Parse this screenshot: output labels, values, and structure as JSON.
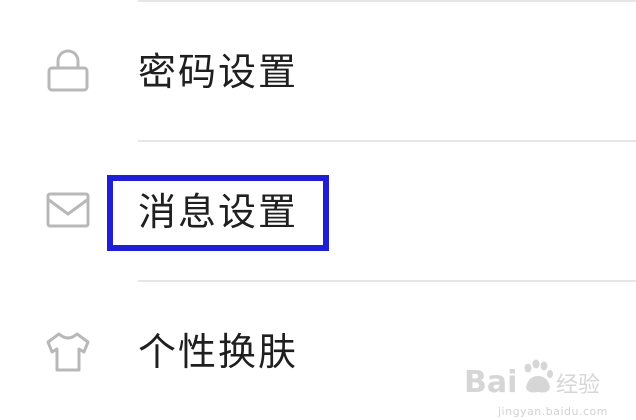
{
  "settings": {
    "items": [
      {
        "label": "密码设置",
        "icon": "lock-icon"
      },
      {
        "label": "消息设置",
        "icon": "envelope-icon"
      },
      {
        "label": "个性换肤",
        "icon": "shirt-icon"
      }
    ]
  },
  "watermark": {
    "brand": "Bai",
    "brand_tail": "经验",
    "url": "jingyan.baidu.com"
  },
  "colors": {
    "highlight": "#1e1ed6",
    "icon_stroke": "#b8b8b8",
    "divider": "#e6e6e6"
  }
}
